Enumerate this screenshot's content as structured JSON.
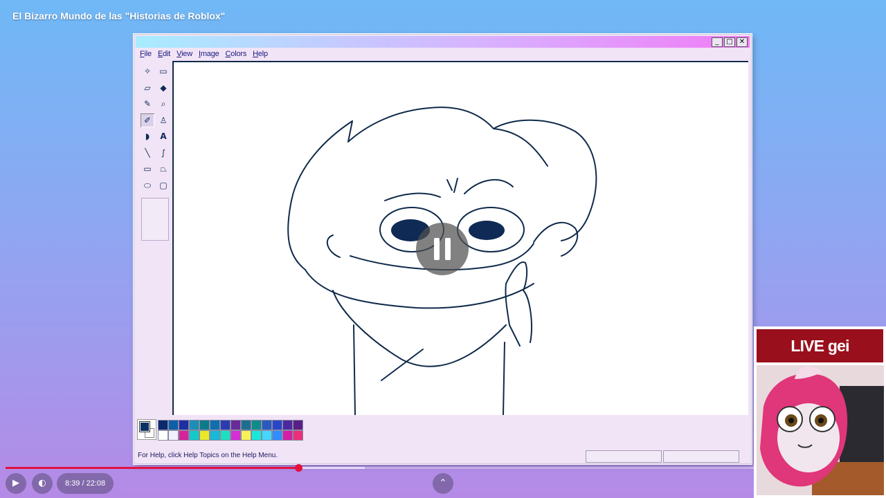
{
  "video": {
    "title": "El Bizarro Mundo de las \"Historias de Roblox\"",
    "current_time": "8:39",
    "duration": "22:08",
    "time_separator": " / ",
    "progress_fraction": 0.391,
    "buffered_fraction": 0.48,
    "state": "paused"
  },
  "paint": {
    "menu": [
      {
        "underline": "F",
        "rest": "ile"
      },
      {
        "underline": "E",
        "rest": "dit"
      },
      {
        "underline": "V",
        "rest": "iew"
      },
      {
        "underline": "I",
        "rest": "mage"
      },
      {
        "underline": "C",
        "rest": "olors"
      },
      {
        "underline": "H",
        "rest": "elp"
      }
    ],
    "window_buttons": {
      "minimize": "_",
      "maximize": "□",
      "close": "✕"
    },
    "status_text": "For Help, click Help Topics on the Help Menu.",
    "tools": [
      {
        "name": "free-select-icon",
        "glyph": "✧"
      },
      {
        "name": "rect-select-icon",
        "glyph": "▭"
      },
      {
        "name": "eraser-icon",
        "glyph": "▱"
      },
      {
        "name": "fill-icon",
        "glyph": "◆"
      },
      {
        "name": "color-picker-icon",
        "glyph": "✎"
      },
      {
        "name": "magnifier-icon",
        "glyph": "⌕"
      },
      {
        "name": "pencil-icon",
        "glyph": "✐"
      },
      {
        "name": "brush-icon",
        "glyph": "♙"
      },
      {
        "name": "airbrush-icon",
        "glyph": "◗"
      },
      {
        "name": "text-icon",
        "glyph": "A"
      },
      {
        "name": "line-icon",
        "glyph": "╲"
      },
      {
        "name": "curve-icon",
        "glyph": "∫"
      },
      {
        "name": "rectangle-icon",
        "glyph": "▭"
      },
      {
        "name": "polygon-icon",
        "glyph": "⏢"
      },
      {
        "name": "ellipse-icon",
        "glyph": "⬭"
      },
      {
        "name": "rounded-rect-icon",
        "glyph": "▢"
      }
    ],
    "palette_top": [
      "#0a2a6e",
      "#0f5ea8",
      "#1f2fa0",
      "#1c8fb8",
      "#0b7b8a",
      "#0e6fae",
      "#2b3cb0",
      "#6a2b9a",
      "#1d6f8f",
      "#0f8b8b",
      "#2a59c0",
      "#2847c8",
      "#4b2aa0",
      "#5a1f86"
    ],
    "palette_bottom": [
      "#ffffff",
      "#f0f0ff",
      "#d4249a",
      "#14c9c9",
      "#e9e92a",
      "#18b9d8",
      "#1edfc0",
      "#d62fd6",
      "#f7f25a",
      "#1ae8d8",
      "#44d8ff",
      "#2f8fff",
      "#d21fa8",
      "#ec2f7a"
    ],
    "foreground_color": "#0c2f64",
    "background_color": "#ffffff"
  },
  "webcam": {
    "banner": "LIVE gei REACTION"
  }
}
